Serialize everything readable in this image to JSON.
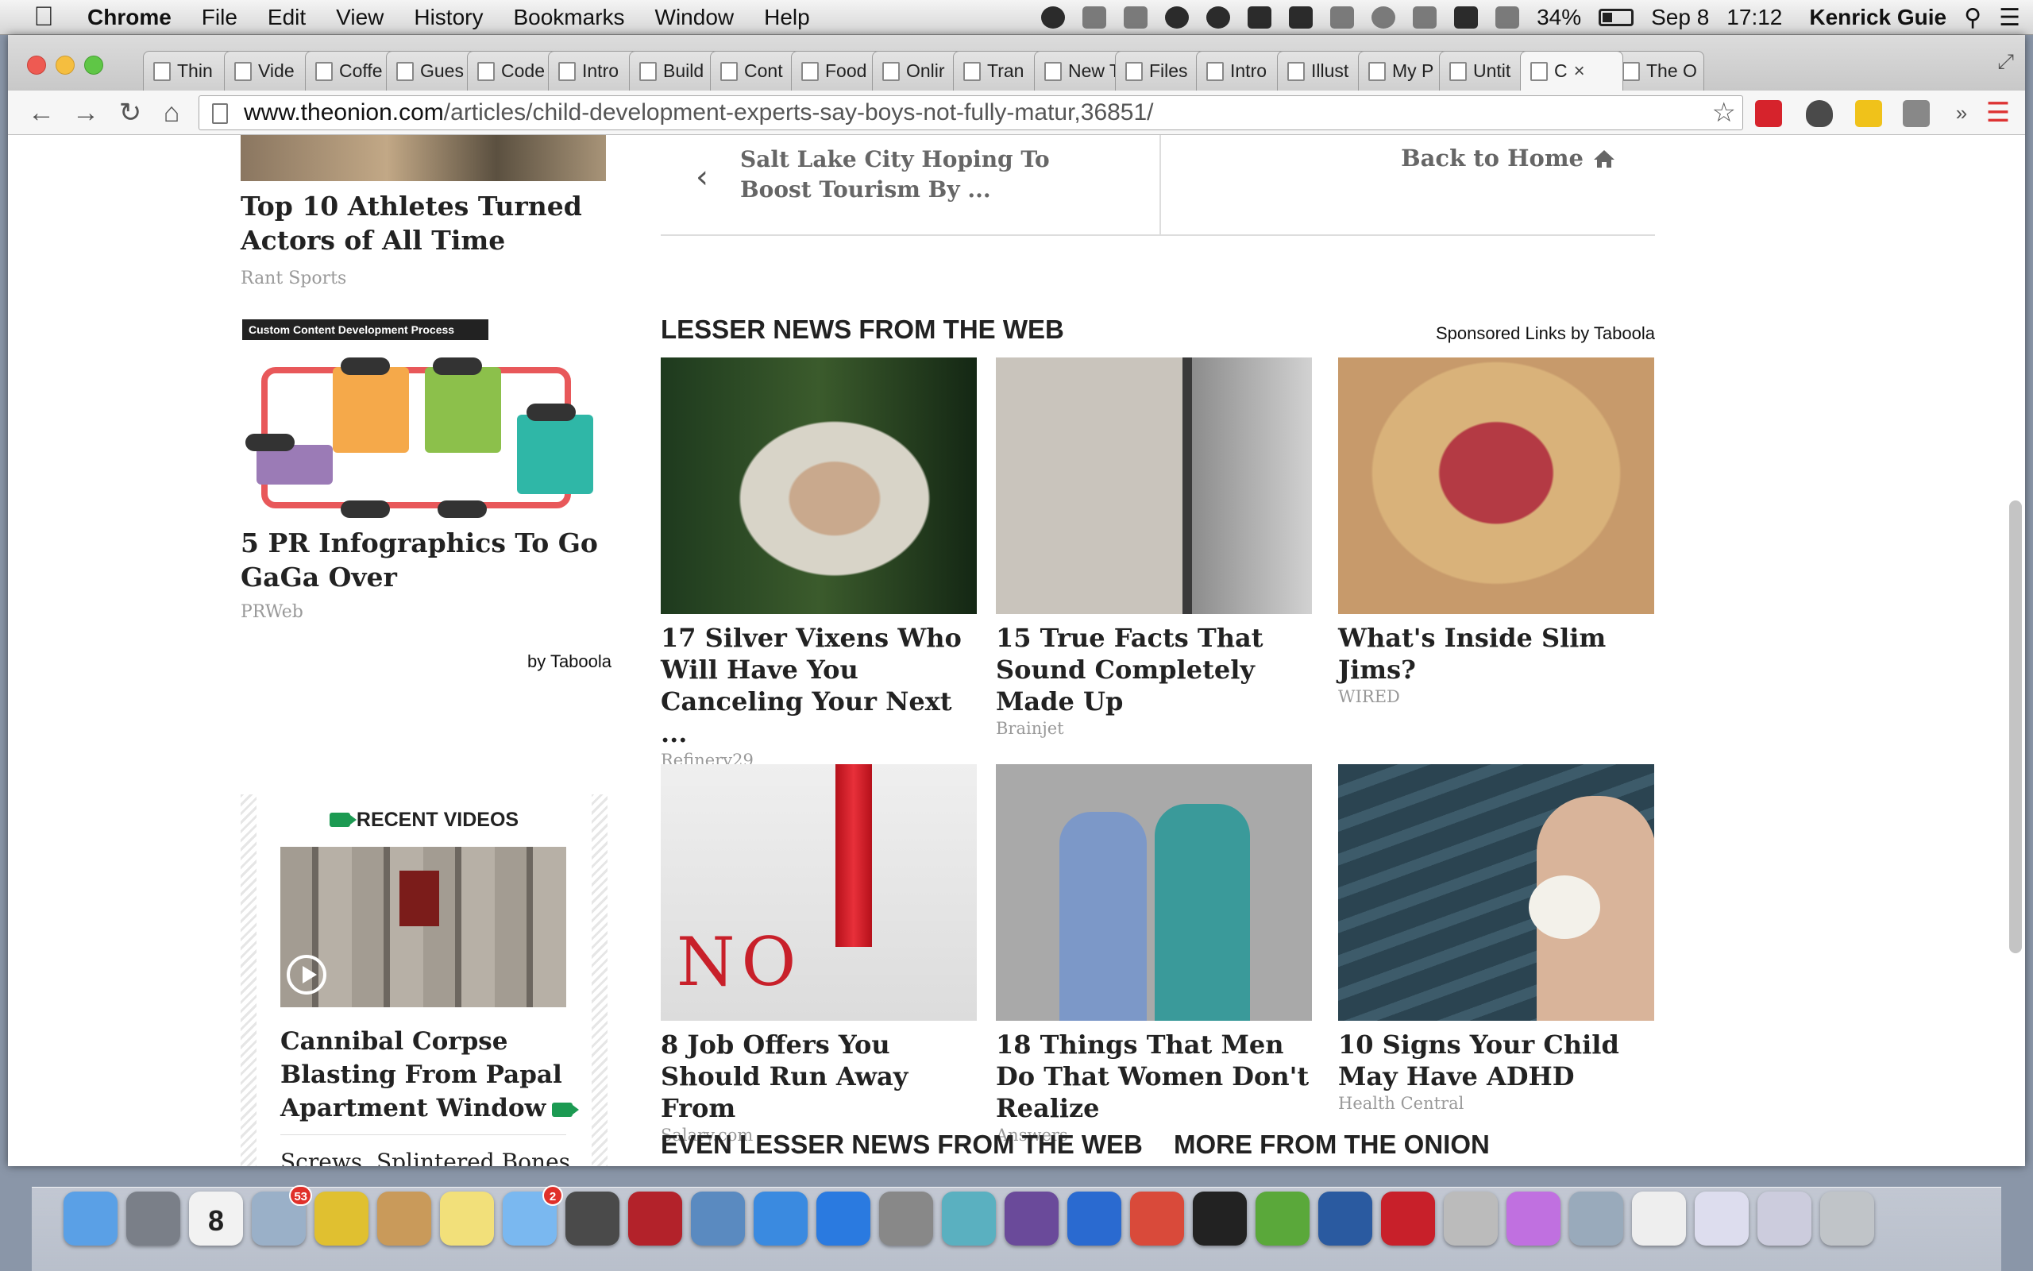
{
  "menubar": {
    "app_name": "Chrome",
    "menus": [
      "File",
      "Edit",
      "View",
      "History",
      "Bookmarks",
      "Window",
      "Help"
    ],
    "battery": "34%",
    "date": "Sep 8",
    "time": "17:12",
    "user": "Kenrick Guie"
  },
  "tabs": [
    {
      "label": "Thin"
    },
    {
      "label": "Vide"
    },
    {
      "label": "Coffe"
    },
    {
      "label": "Gues"
    },
    {
      "label": "Code"
    },
    {
      "label": "Intro"
    },
    {
      "label": "Build"
    },
    {
      "label": "Cont"
    },
    {
      "label": "Food"
    },
    {
      "label": "Onlir"
    },
    {
      "label": "Tran"
    },
    {
      "label": "New Tal"
    },
    {
      "label": "Files"
    },
    {
      "label": "Intro"
    },
    {
      "label": "Illust"
    },
    {
      "label": "My P"
    },
    {
      "label": "Untit"
    },
    {
      "label": "C",
      "active": true
    },
    {
      "label": "The O"
    }
  ],
  "toolbar": {
    "url_host": "www.theonion.com",
    "url_path": "/articles/child-development-experts-say-boys-not-fully-matur,36851/"
  },
  "sidebar": {
    "item1": {
      "title": "Top 10 Athletes Turned Actors of All Time",
      "source": "Rant Sports"
    },
    "infographic_header": "Custom Content Development Process",
    "item2": {
      "title": "5 PR Infographics To Go GaGa Over",
      "source": "PRWeb"
    },
    "by_taboola": "by Taboola",
    "recent_videos": {
      "heading": "RECENT VIDEOS",
      "video_title": "Cannibal Corpse Blasting From Papal Apartment Window",
      "next_title": "Screws, Splintered Bones,"
    }
  },
  "main": {
    "prev_article": "Salt Lake City Hoping To Boost Tourism By ...",
    "back_home": "Back to Home",
    "lesser_heading": "LESSER NEWS FROM THE WEB",
    "sponsored": "Sponsored Links by Taboola",
    "cards": [
      {
        "title": "17 Silver Vixens Who Will Have You Canceling Your Next ...",
        "source": "Refinery29"
      },
      {
        "title": "15 True Facts That Sound Completely Made Up",
        "source": "Brainjet"
      },
      {
        "title": "What's Inside Slim Jims?",
        "source": "WIRED"
      },
      {
        "title": "8 Job Offers You Should Run Away From",
        "source": "Salary.com"
      },
      {
        "title": "18 Things That Men Do That Women Don't Realize",
        "source": "Answers"
      },
      {
        "title": "10 Signs Your Child May Have ADHD",
        "source": "Health Central"
      }
    ],
    "even_lesser_heading": "EVEN LESSER NEWS FROM THE WEB",
    "more_heading": "MORE FROM THE ONION"
  },
  "dock": {
    "calendar_day": "8",
    "mail_badge": "53",
    "messages_badge": "2"
  },
  "colors": {
    "onion_green": "#1c9a52",
    "chrome_tabstrip": "#d0d0d0",
    "heading_text": "#222222",
    "source_text": "#999999"
  }
}
